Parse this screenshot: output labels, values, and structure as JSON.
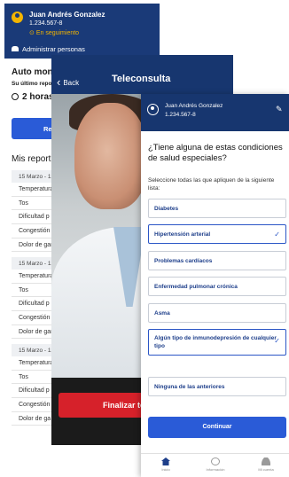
{
  "screen_home": {
    "user_name": "Juan Andrés Gonzalez",
    "user_id": "1.234.567-8",
    "status": "En seguimiento",
    "admin_label": "Administrar personas",
    "auto_title": "Auto moni",
    "last_report_label": "Su último repo",
    "hours_value": "2 horas",
    "report_button_label": "Rep",
    "my_reports_title": "Mis report",
    "report_groups": [
      {
        "date": "15 Marzo - 12",
        "symptoms": [
          "Temperatura",
          "Tos",
          "Dificultad p",
          "Congestión",
          "Dolor de gar"
        ]
      },
      {
        "date": "15 Marzo - 12",
        "symptoms": [
          "Temperatura",
          "Tos",
          "Dificultad p",
          "Congestión",
          "Dolor de gar"
        ]
      },
      {
        "date": "15 Marzo - 12",
        "symptoms": [
          "Temperatura",
          "Tos",
          "Dificultad p",
          "Congestión",
          "Dolor de ga"
        ]
      }
    ]
  },
  "screen_video": {
    "back_label": "Back",
    "title": "Teleconsulta",
    "end_button_label": "Finalizar te"
  },
  "screen_conditions": {
    "user_name": "Juan Andrés Gonzalez",
    "user_id": "1.234.567-8",
    "question": "¿Tiene alguna de estas condiciones de salud especiales?",
    "hint": "Seleccione todas las que apliquen de la siguiente lista:",
    "options": [
      {
        "label": "Diabetes",
        "selected": false
      },
      {
        "label": "Hipertensión arterial",
        "selected": true
      },
      {
        "label": "Problemas cardíacos",
        "selected": false
      },
      {
        "label": "Enfermedad pulmonar crónica",
        "selected": false
      },
      {
        "label": "Asma",
        "selected": false
      },
      {
        "label": "Algún tipo de inmunodepresión de cualquier tipo",
        "selected": true
      },
      {
        "label": "Ninguna de las anteriores",
        "selected": false
      }
    ],
    "continue_label": "Continuar",
    "nav": [
      "Inicio",
      "Información",
      "Mi cuenta"
    ]
  },
  "colors": {
    "header_blue": "#17366f",
    "primary_blue": "#2a5bd7",
    "status_yellow": "#f2b400",
    "danger_red": "#d6212a"
  }
}
